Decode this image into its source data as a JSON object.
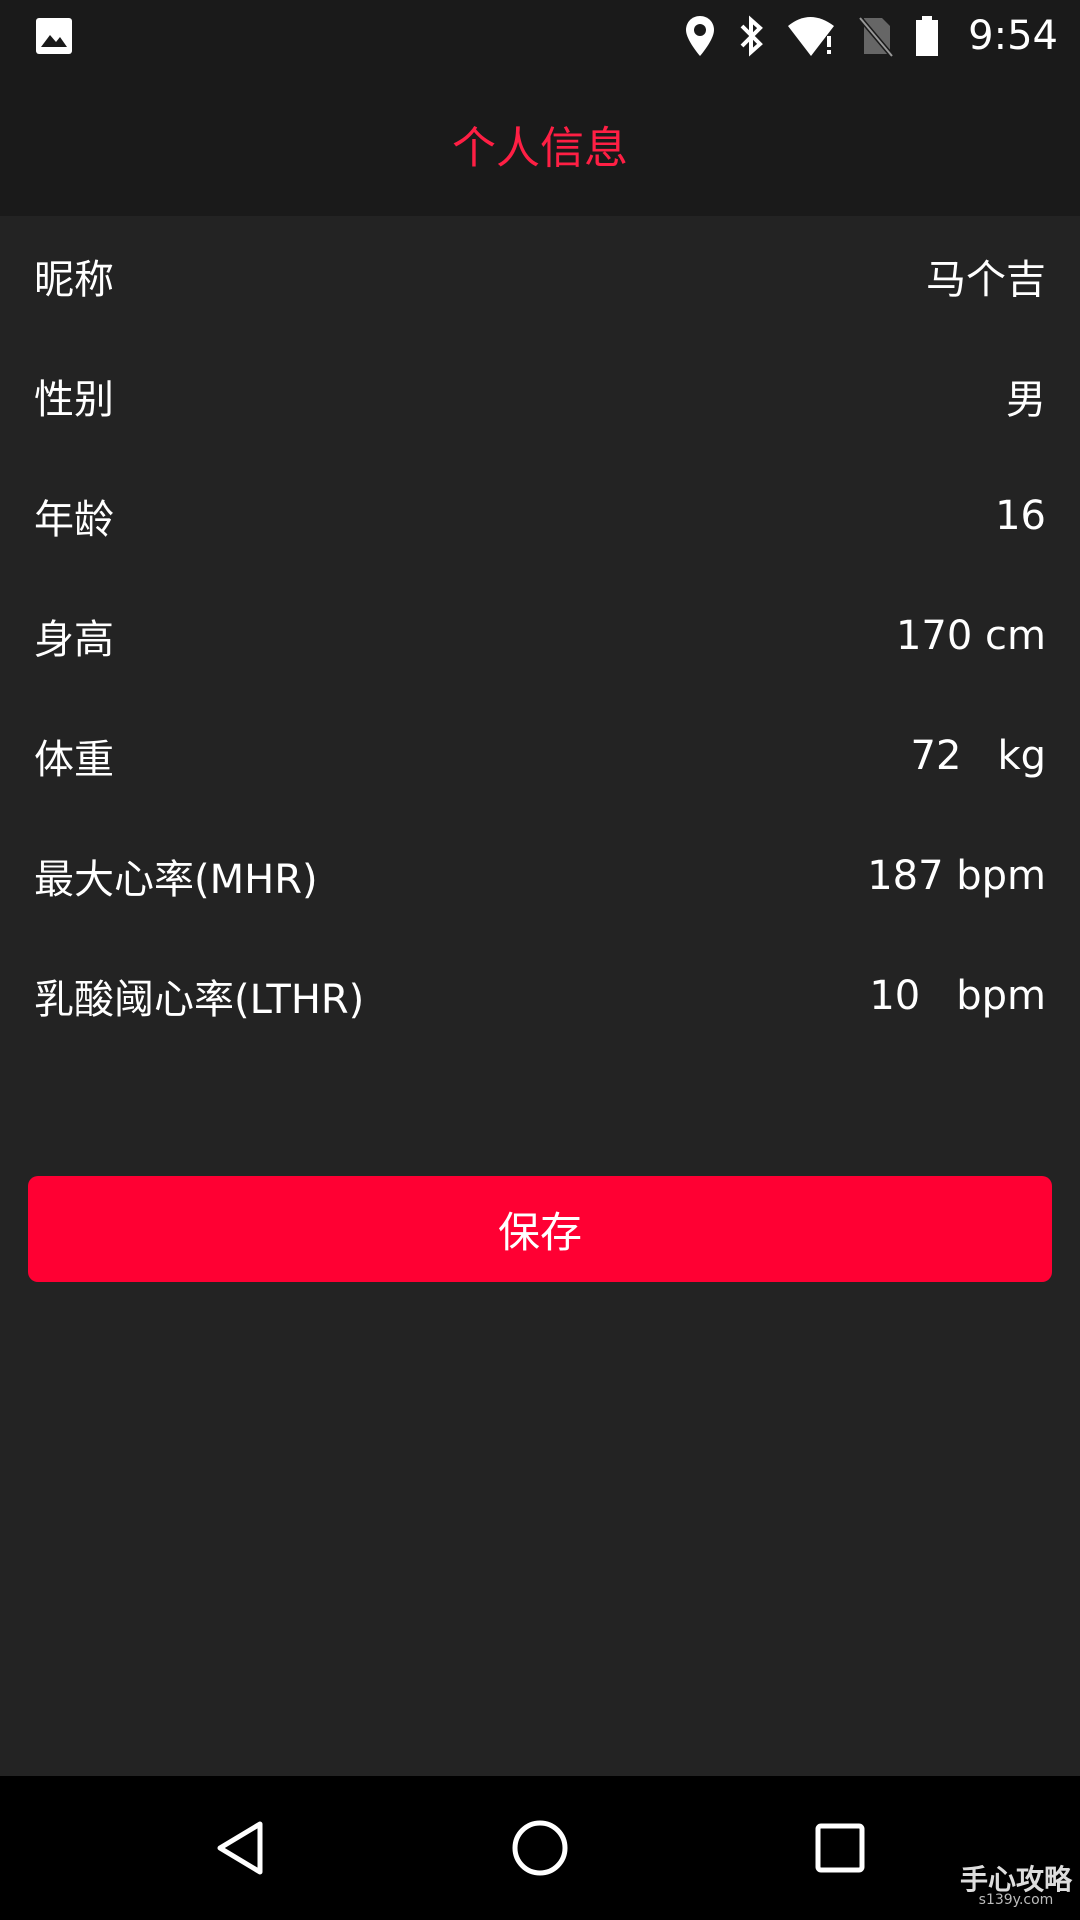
{
  "status_bar": {
    "time": "9:54",
    "icons": [
      "image-icon",
      "location-icon",
      "bluetooth-icon",
      "wifi-alert-icon",
      "no-sim-icon",
      "battery-icon"
    ]
  },
  "header": {
    "title": "个人信息"
  },
  "profile_rows": [
    {
      "label": "昵称",
      "value": "马个吉",
      "unit": ""
    },
    {
      "label": "性别",
      "value": "男",
      "unit": ""
    },
    {
      "label": "年龄",
      "value": "16",
      "unit": ""
    },
    {
      "label": "身高",
      "value": "170 cm",
      "unit": ""
    },
    {
      "label": "体重",
      "value": "72",
      "unit": "kg"
    },
    {
      "label": "最大心率(MHR)",
      "value": "187 bpm",
      "unit": ""
    },
    {
      "label": "乳酸阈心率(LTHR)",
      "value": "10",
      "unit": "bpm"
    }
  ],
  "actions": {
    "save_label": "保存"
  },
  "nav_bar": {
    "icons": [
      "back-icon",
      "home-icon",
      "recents-icon"
    ]
  },
  "watermark": {
    "text": "手心攻略",
    "sub": "s139y.com"
  },
  "colors": {
    "accent": "#ff0033",
    "title": "#ff1f44",
    "background": "#232323",
    "bar": "#1a1a1a"
  }
}
